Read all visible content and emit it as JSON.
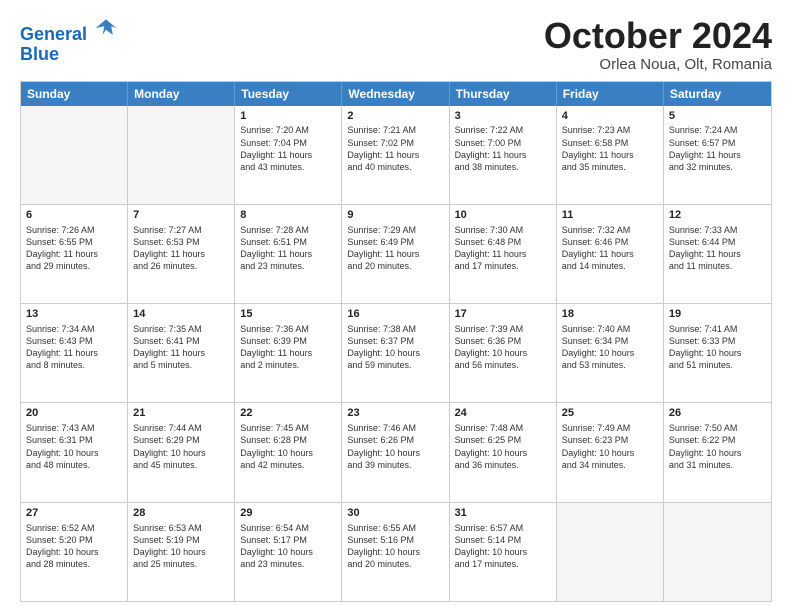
{
  "logo": {
    "line1": "General",
    "line2": "Blue"
  },
  "title": "October 2024",
  "subtitle": "Orlea Noua, Olt, Romania",
  "header_days": [
    "Sunday",
    "Monday",
    "Tuesday",
    "Wednesday",
    "Thursday",
    "Friday",
    "Saturday"
  ],
  "weeks": [
    [
      {
        "day": "",
        "empty": true
      },
      {
        "day": "",
        "empty": true
      },
      {
        "day": "1",
        "line1": "Sunrise: 7:20 AM",
        "line2": "Sunset: 7:04 PM",
        "line3": "Daylight: 11 hours",
        "line4": "and 43 minutes."
      },
      {
        "day": "2",
        "line1": "Sunrise: 7:21 AM",
        "line2": "Sunset: 7:02 PM",
        "line3": "Daylight: 11 hours",
        "line4": "and 40 minutes."
      },
      {
        "day": "3",
        "line1": "Sunrise: 7:22 AM",
        "line2": "Sunset: 7:00 PM",
        "line3": "Daylight: 11 hours",
        "line4": "and 38 minutes."
      },
      {
        "day": "4",
        "line1": "Sunrise: 7:23 AM",
        "line2": "Sunset: 6:58 PM",
        "line3": "Daylight: 11 hours",
        "line4": "and 35 minutes."
      },
      {
        "day": "5",
        "line1": "Sunrise: 7:24 AM",
        "line2": "Sunset: 6:57 PM",
        "line3": "Daylight: 11 hours",
        "line4": "and 32 minutes."
      }
    ],
    [
      {
        "day": "6",
        "line1": "Sunrise: 7:26 AM",
        "line2": "Sunset: 6:55 PM",
        "line3": "Daylight: 11 hours",
        "line4": "and 29 minutes."
      },
      {
        "day": "7",
        "line1": "Sunrise: 7:27 AM",
        "line2": "Sunset: 6:53 PM",
        "line3": "Daylight: 11 hours",
        "line4": "and 26 minutes."
      },
      {
        "day": "8",
        "line1": "Sunrise: 7:28 AM",
        "line2": "Sunset: 6:51 PM",
        "line3": "Daylight: 11 hours",
        "line4": "and 23 minutes."
      },
      {
        "day": "9",
        "line1": "Sunrise: 7:29 AM",
        "line2": "Sunset: 6:49 PM",
        "line3": "Daylight: 11 hours",
        "line4": "and 20 minutes."
      },
      {
        "day": "10",
        "line1": "Sunrise: 7:30 AM",
        "line2": "Sunset: 6:48 PM",
        "line3": "Daylight: 11 hours",
        "line4": "and 17 minutes."
      },
      {
        "day": "11",
        "line1": "Sunrise: 7:32 AM",
        "line2": "Sunset: 6:46 PM",
        "line3": "Daylight: 11 hours",
        "line4": "and 14 minutes."
      },
      {
        "day": "12",
        "line1": "Sunrise: 7:33 AM",
        "line2": "Sunset: 6:44 PM",
        "line3": "Daylight: 11 hours",
        "line4": "and 11 minutes."
      }
    ],
    [
      {
        "day": "13",
        "line1": "Sunrise: 7:34 AM",
        "line2": "Sunset: 6:43 PM",
        "line3": "Daylight: 11 hours",
        "line4": "and 8 minutes."
      },
      {
        "day": "14",
        "line1": "Sunrise: 7:35 AM",
        "line2": "Sunset: 6:41 PM",
        "line3": "Daylight: 11 hours",
        "line4": "and 5 minutes."
      },
      {
        "day": "15",
        "line1": "Sunrise: 7:36 AM",
        "line2": "Sunset: 6:39 PM",
        "line3": "Daylight: 11 hours",
        "line4": "and 2 minutes."
      },
      {
        "day": "16",
        "line1": "Sunrise: 7:38 AM",
        "line2": "Sunset: 6:37 PM",
        "line3": "Daylight: 10 hours",
        "line4": "and 59 minutes."
      },
      {
        "day": "17",
        "line1": "Sunrise: 7:39 AM",
        "line2": "Sunset: 6:36 PM",
        "line3": "Daylight: 10 hours",
        "line4": "and 56 minutes."
      },
      {
        "day": "18",
        "line1": "Sunrise: 7:40 AM",
        "line2": "Sunset: 6:34 PM",
        "line3": "Daylight: 10 hours",
        "line4": "and 53 minutes."
      },
      {
        "day": "19",
        "line1": "Sunrise: 7:41 AM",
        "line2": "Sunset: 6:33 PM",
        "line3": "Daylight: 10 hours",
        "line4": "and 51 minutes."
      }
    ],
    [
      {
        "day": "20",
        "line1": "Sunrise: 7:43 AM",
        "line2": "Sunset: 6:31 PM",
        "line3": "Daylight: 10 hours",
        "line4": "and 48 minutes."
      },
      {
        "day": "21",
        "line1": "Sunrise: 7:44 AM",
        "line2": "Sunset: 6:29 PM",
        "line3": "Daylight: 10 hours",
        "line4": "and 45 minutes."
      },
      {
        "day": "22",
        "line1": "Sunrise: 7:45 AM",
        "line2": "Sunset: 6:28 PM",
        "line3": "Daylight: 10 hours",
        "line4": "and 42 minutes."
      },
      {
        "day": "23",
        "line1": "Sunrise: 7:46 AM",
        "line2": "Sunset: 6:26 PM",
        "line3": "Daylight: 10 hours",
        "line4": "and 39 minutes."
      },
      {
        "day": "24",
        "line1": "Sunrise: 7:48 AM",
        "line2": "Sunset: 6:25 PM",
        "line3": "Daylight: 10 hours",
        "line4": "and 36 minutes."
      },
      {
        "day": "25",
        "line1": "Sunrise: 7:49 AM",
        "line2": "Sunset: 6:23 PM",
        "line3": "Daylight: 10 hours",
        "line4": "and 34 minutes."
      },
      {
        "day": "26",
        "line1": "Sunrise: 7:50 AM",
        "line2": "Sunset: 6:22 PM",
        "line3": "Daylight: 10 hours",
        "line4": "and 31 minutes."
      }
    ],
    [
      {
        "day": "27",
        "line1": "Sunrise: 6:52 AM",
        "line2": "Sunset: 5:20 PM",
        "line3": "Daylight: 10 hours",
        "line4": "and 28 minutes."
      },
      {
        "day": "28",
        "line1": "Sunrise: 6:53 AM",
        "line2": "Sunset: 5:19 PM",
        "line3": "Daylight: 10 hours",
        "line4": "and 25 minutes."
      },
      {
        "day": "29",
        "line1": "Sunrise: 6:54 AM",
        "line2": "Sunset: 5:17 PM",
        "line3": "Daylight: 10 hours",
        "line4": "and 23 minutes."
      },
      {
        "day": "30",
        "line1": "Sunrise: 6:55 AM",
        "line2": "Sunset: 5:16 PM",
        "line3": "Daylight: 10 hours",
        "line4": "and 20 minutes."
      },
      {
        "day": "31",
        "line1": "Sunrise: 6:57 AM",
        "line2": "Sunset: 5:14 PM",
        "line3": "Daylight: 10 hours",
        "line4": "and 17 minutes."
      },
      {
        "day": "",
        "empty": true
      },
      {
        "day": "",
        "empty": true
      }
    ]
  ]
}
